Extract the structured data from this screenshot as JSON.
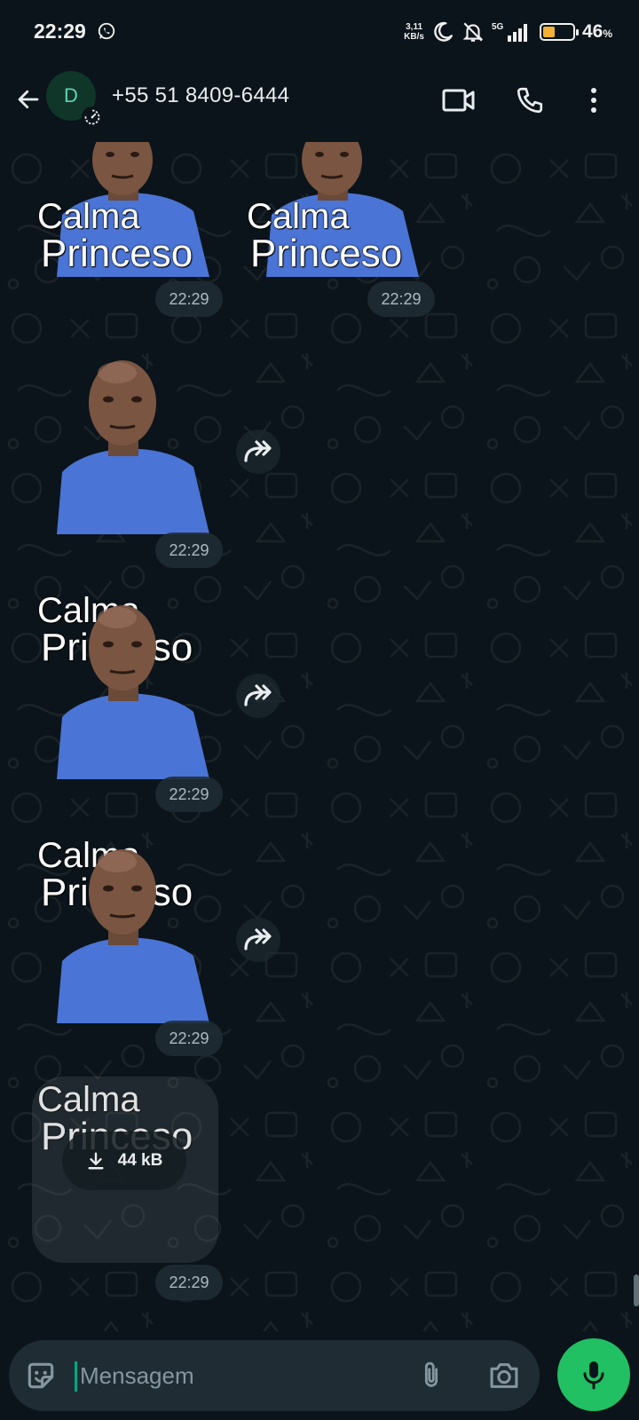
{
  "status_bar": {
    "time": "22:29",
    "net_speed_value": "3,11",
    "net_speed_unit": "KB/s",
    "network_type": "5G",
    "battery_percent": "46",
    "battery_percent_sign": "%",
    "battery_level": 0.46,
    "battery_color": "#f2b134",
    "icons": [
      "whatsapp-icon",
      "moon-icon",
      "bell-off-icon",
      "signal-icon",
      "battery-icon"
    ]
  },
  "header": {
    "avatar_letter": "D",
    "contact_name": "+55 51 8409-6444",
    "icons": [
      "back-arrow-icon",
      "timer-icon",
      "video-call-icon",
      "phone-icon",
      "more-vert-icon"
    ]
  },
  "messages": [
    {
      "type": "sticker",
      "text_line1": "Calma",
      "text_line2": "Princeso",
      "time": "22:29"
    },
    {
      "type": "sticker",
      "text_line1": "Calma",
      "text_line2": "Princeso",
      "time": "22:29"
    },
    {
      "type": "sticker",
      "text_line1": "Calma",
      "text_line2": "Princeso",
      "time": "22:29",
      "forward": true
    },
    {
      "type": "sticker",
      "text_line1": "Calma",
      "text_line2": "Princeso",
      "time": "22:29",
      "forward": true
    },
    {
      "type": "sticker",
      "text_line1": "Calma",
      "text_line2": "Princeso",
      "time": "22:29",
      "forward": true
    },
    {
      "type": "pending_sticker",
      "download_size": "44 kB",
      "time": "22:29"
    }
  ],
  "composer": {
    "placeholder": "Mensagem",
    "value": "",
    "icons": [
      "sticker-emoji-icon",
      "paperclip-icon",
      "camera-icon",
      "mic-icon"
    ]
  },
  "colors": {
    "background": "#0b141a",
    "accent_green": "#21c063",
    "input_bg": "#1f2c34",
    "timestamp_text": "#aebac1",
    "sticker_shirt": "#4a74d6"
  }
}
